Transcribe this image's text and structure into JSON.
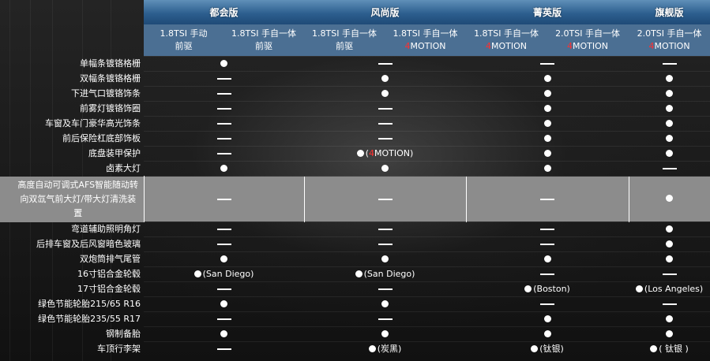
{
  "trims": [
    {
      "name": "都会版",
      "span": 2
    },
    {
      "name": "风尚版",
      "span": 2
    },
    {
      "name": "菁英版",
      "span": 2
    },
    {
      "name": "旗舰版",
      "span": 1
    }
  ],
  "variants": [
    {
      "line1": "1.8TSI 手动",
      "line2_hl": "",
      "line2": "前驱"
    },
    {
      "line1": "1.8TSI 手自一体",
      "line2_hl": "",
      "line2": "前驱"
    },
    {
      "line1": "1.8TSI 手自一体",
      "line2_hl": "",
      "line2": "前驱"
    },
    {
      "line1": "1.8TSI 手自一体",
      "line2_hl": "4",
      "line2": "MOTION"
    },
    {
      "line1": "1.8TSI 手自一体",
      "line2_hl": "4",
      "line2": "MOTION"
    },
    {
      "line1": "2.0TSI 手自一体",
      "line2_hl": "4",
      "line2": "MOTION"
    },
    {
      "line1": "2.0TSI 手自一体",
      "line2_hl": "4",
      "line2": "MOTION"
    }
  ],
  "features": [
    {
      "label": "单幅条镀铬格栅",
      "cells": [
        {
          "v": "dot",
          "span": 2
        },
        {
          "v": "dash",
          "span": 2
        },
        {
          "v": "dash",
          "span": 2
        },
        {
          "v": "dash",
          "span": 1
        }
      ]
    },
    {
      "label": "双幅条镀铬格栅",
      "cells": [
        {
          "v": "dash",
          "span": 2
        },
        {
          "v": "dot",
          "span": 2
        },
        {
          "v": "dot",
          "span": 2
        },
        {
          "v": "dot",
          "span": 1
        }
      ]
    },
    {
      "label": "下进气口镀铬饰条",
      "cells": [
        {
          "v": "dash",
          "span": 2
        },
        {
          "v": "dot",
          "span": 2
        },
        {
          "v": "dot",
          "span": 2
        },
        {
          "v": "dot",
          "span": 1
        }
      ]
    },
    {
      "label": "前雾灯镀铬饰圈",
      "cells": [
        {
          "v": "dash",
          "span": 2
        },
        {
          "v": "dash",
          "span": 2
        },
        {
          "v": "dot",
          "span": 2
        },
        {
          "v": "dot",
          "span": 1
        }
      ]
    },
    {
      "label": "车窗及车门豪华高光饰条",
      "cells": [
        {
          "v": "dash",
          "span": 2
        },
        {
          "v": "dash",
          "span": 2
        },
        {
          "v": "dot",
          "span": 2
        },
        {
          "v": "dot",
          "span": 1
        }
      ]
    },
    {
      "label": "前后保险杠底部饰板",
      "cells": [
        {
          "v": "dash",
          "span": 2
        },
        {
          "v": "dash",
          "span": 2
        },
        {
          "v": "dot",
          "span": 2
        },
        {
          "v": "dot",
          "span": 1
        }
      ]
    },
    {
      "label": "底盘装甲保护",
      "cells": [
        {
          "v": "dash",
          "span": 2
        },
        {
          "v": "dot",
          "span": 2,
          "note_pre": "(",
          "note_hl": "4",
          "note": "MOTION)"
        },
        {
          "v": "dot",
          "span": 2
        },
        {
          "v": "dot",
          "span": 1
        }
      ]
    },
    {
      "label": "卤素大灯",
      "cells": [
        {
          "v": "dot",
          "span": 2
        },
        {
          "v": "dot",
          "span": 2
        },
        {
          "v": "dot",
          "span": 2
        },
        {
          "v": "dash",
          "span": 1
        }
      ]
    },
    {
      "label": "高度自动可调式AFS智能随动转向双氙气前大灯/带大灯清洗装置",
      "grey": true,
      "cells": [
        {
          "v": "dash",
          "span": 2
        },
        {
          "v": "dash",
          "span": 2
        },
        {
          "v": "dash",
          "span": 2
        },
        {
          "v": "dot",
          "span": 1
        }
      ]
    },
    {
      "label": "弯道辅助照明角灯",
      "cells": [
        {
          "v": "dash",
          "span": 2
        },
        {
          "v": "dash",
          "span": 2
        },
        {
          "v": "dash",
          "span": 2
        },
        {
          "v": "dot",
          "span": 1
        }
      ]
    },
    {
      "label": "后排车窗及后风窗暗色玻璃",
      "cells": [
        {
          "v": "dash",
          "span": 2
        },
        {
          "v": "dash",
          "span": 2
        },
        {
          "v": "dash",
          "span": 2
        },
        {
          "v": "dot",
          "span": 1
        }
      ]
    },
    {
      "label": "双炮筒排气尾管",
      "cells": [
        {
          "v": "dot",
          "span": 2
        },
        {
          "v": "dot",
          "span": 2
        },
        {
          "v": "dot",
          "span": 2
        },
        {
          "v": "dot",
          "span": 1
        }
      ]
    },
    {
      "label": "16寸铝合金轮毂",
      "cells": [
        {
          "v": "dot",
          "span": 2,
          "note": "(San Diego)"
        },
        {
          "v": "dot",
          "span": 2,
          "note": "(San Diego)"
        },
        {
          "v": "dash",
          "span": 2
        },
        {
          "v": "dash",
          "span": 1
        }
      ]
    },
    {
      "label": "17寸铝合金轮毂",
      "cells": [
        {
          "v": "dash",
          "span": 2
        },
        {
          "v": "dash",
          "span": 2
        },
        {
          "v": "dot",
          "span": 2,
          "note": "(Boston)"
        },
        {
          "v": "dot",
          "span": 1,
          "note": "(Los Angeles)"
        }
      ]
    },
    {
      "label": "绿色节能轮胎215/65 R16",
      "cells": [
        {
          "v": "dot",
          "span": 2
        },
        {
          "v": "dot",
          "span": 2
        },
        {
          "v": "dash",
          "span": 2
        },
        {
          "v": "dash",
          "span": 1
        }
      ]
    },
    {
      "label": "绿色节能轮胎235/55 R17",
      "cells": [
        {
          "v": "dash",
          "span": 2
        },
        {
          "v": "dash",
          "span": 2
        },
        {
          "v": "dot",
          "span": 2
        },
        {
          "v": "dot",
          "span": 1
        }
      ]
    },
    {
      "label": "钢制备胎",
      "cells": [
        {
          "v": "dot",
          "span": 2
        },
        {
          "v": "dot",
          "span": 2
        },
        {
          "v": "dot",
          "span": 2
        },
        {
          "v": "dot",
          "span": 1
        }
      ]
    },
    {
      "label": "车顶行李架",
      "cells": [
        {
          "v": "dash",
          "span": 2
        },
        {
          "v": "dot",
          "span": 2,
          "note": "(炭黑)"
        },
        {
          "v": "dot",
          "span": 2,
          "note": "(钛银)"
        },
        {
          "v": "dot",
          "span": 1,
          "note": "( 钛银 )"
        }
      ]
    }
  ]
}
